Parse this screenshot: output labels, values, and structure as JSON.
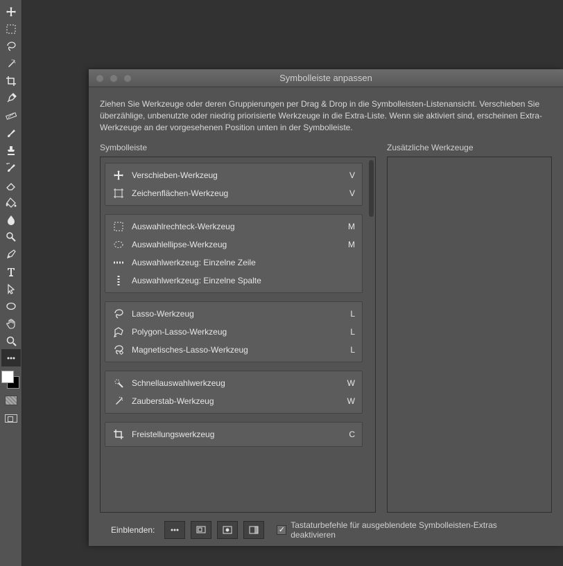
{
  "toolstrip": {
    "selected_index": 20,
    "icons": [
      "move-icon",
      "marquee-icon",
      "lasso-icon",
      "wand-icon",
      "crop-icon",
      "eyedropper-icon",
      "ruler-icon",
      "brush-icon",
      "stamp-icon",
      "history-brush-icon",
      "eraser-icon",
      "bucket-icon",
      "blur-icon",
      "dodge-icon",
      "pen-icon",
      "type-icon",
      "pointer-icon",
      "ellipse-icon",
      "hand-icon",
      "zoom-icon",
      "more-icon"
    ]
  },
  "dialog": {
    "title": "Symbolleiste anpassen",
    "instructions": "Ziehen Sie Werkzeuge oder deren Gruppierungen per Drag & Drop in die Symbolleisten-Listenansicht. Verschieben Sie überzählige, unbenutzte oder niedrig priorisierte Werkzeuge in die Extra-Liste. Wenn sie aktiviert sind, erscheinen Extra-Werkzeuge an der vorgesehenen Position unten in der Symbolleiste.",
    "left_label": "Symbolleiste",
    "right_label": "Zusätzliche Werkzeuge",
    "groups": [
      {
        "items": [
          {
            "icon": "move-icon",
            "name": "Verschieben-Werkzeug",
            "key": "V"
          },
          {
            "icon": "artboard-icon",
            "name": "Zeichenflächen-Werkzeug",
            "key": "V"
          }
        ]
      },
      {
        "items": [
          {
            "icon": "marquee-icon",
            "name": "Auswahlrechteck-Werkzeug",
            "key": "M"
          },
          {
            "icon": "ellipse-marquee-icon",
            "name": "Auswahlellipse-Werkzeug",
            "key": "M"
          },
          {
            "icon": "row-marquee-icon",
            "name": "Auswahlwerkzeug: Einzelne Zeile",
            "key": ""
          },
          {
            "icon": "col-marquee-icon",
            "name": "Auswahlwerkzeug: Einzelne Spalte",
            "key": ""
          }
        ]
      },
      {
        "items": [
          {
            "icon": "lasso-icon",
            "name": "Lasso-Werkzeug",
            "key": "L"
          },
          {
            "icon": "poly-lasso-icon",
            "name": "Polygon-Lasso-Werkzeug",
            "key": "L"
          },
          {
            "icon": "mag-lasso-icon",
            "name": "Magnetisches-Lasso-Werkzeug",
            "key": "L"
          }
        ]
      },
      {
        "items": [
          {
            "icon": "quick-select-icon",
            "name": "Schnellauswahlwerkzeug",
            "key": "W"
          },
          {
            "icon": "wand-icon",
            "name": "Zauberstab-Werkzeug",
            "key": "W"
          }
        ]
      },
      {
        "items": [
          {
            "icon": "crop-icon",
            "name": "Freistellungswerkzeug",
            "key": "C"
          }
        ]
      }
    ],
    "footer": {
      "label": "Einblenden:",
      "buttons": [
        "more-icon",
        "screen-icon",
        "qmask-icon",
        "panels-icon"
      ],
      "checkbox_checked": true,
      "checkbox_label": "Tastaturbefehle für ausgeblendete Symbolleisten-Extras deaktivieren"
    }
  }
}
